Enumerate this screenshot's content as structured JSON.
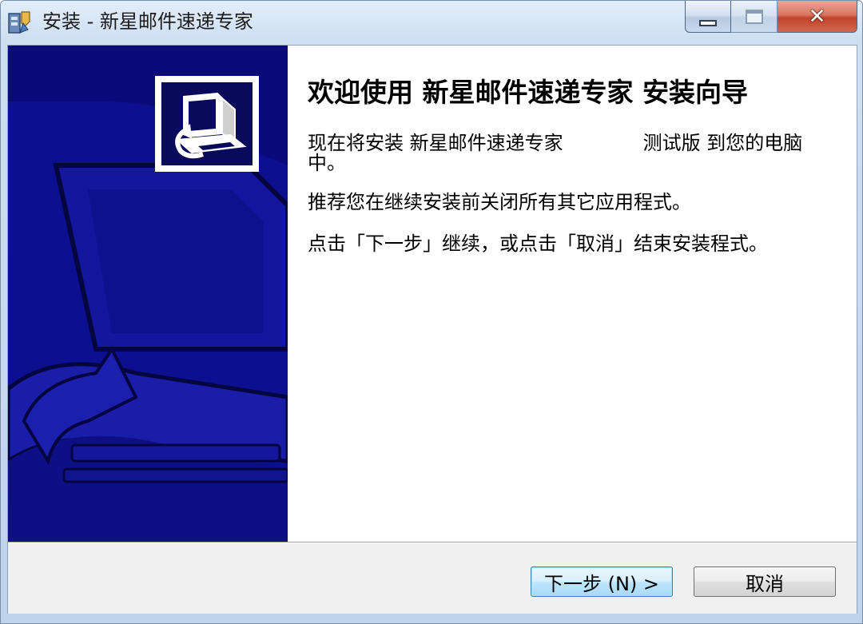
{
  "window": {
    "title": "安装 - 新星邮件速递专家",
    "close_glyph": "✕"
  },
  "content": {
    "heading": "欢迎使用 新星邮件速递专家 安装向导",
    "install_prefix": "现在将安装 新星邮件速递专家",
    "install_suffix": "测试版 到您的电脑中。",
    "recommend": "推荐您在继续安装前关闭所有其它应用程式。",
    "instruction": "点击「下一步」继续，或点击「取消」结束安装程式。"
  },
  "buttons": {
    "next": "下一步 (N) >",
    "cancel": "取消"
  },
  "colors": {
    "side_panel": "#0a0a7a",
    "accent_blue": "#3c7fb1",
    "close_red": "#c0432a"
  },
  "icons": {
    "app": "installer-app-icon",
    "logo": "computer-install-logo-icon"
  }
}
